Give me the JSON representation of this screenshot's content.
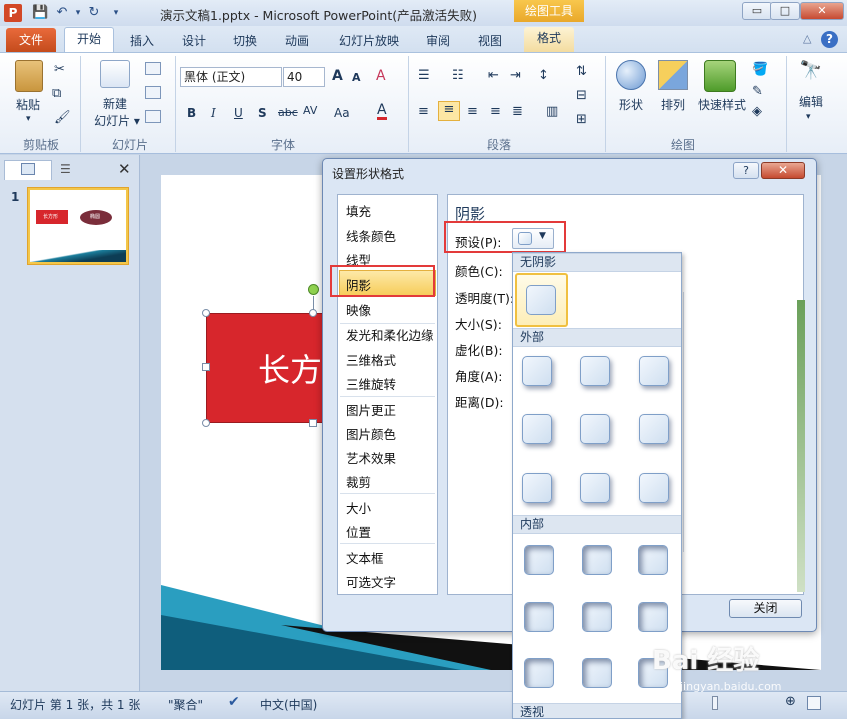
{
  "titlebar": {
    "app_letter": "P",
    "title": "演示文稿1.pptx - Microsoft PowerPoint(产品激活失败)",
    "context_tool": "绘图工具",
    "min": "▭",
    "max": "□",
    "close": "✕"
  },
  "tabs": [
    "文件",
    "开始",
    "插入",
    "设计",
    "切换",
    "动画",
    "幻灯片放映",
    "审阅",
    "视图",
    "格式"
  ],
  "help": {
    "up": "△",
    "q": "?"
  },
  "ribbon": {
    "clipboard": {
      "paste": "粘贴",
      "label": "剪贴板"
    },
    "slides": {
      "new_line1": "新建",
      "new_line2": "幻灯片 ▾",
      "label": "幻灯片"
    },
    "font": {
      "name": "黑体 (正文)",
      "size": "40",
      "grow": "A",
      "shrink": "A",
      "clear": "A",
      "bold": "B",
      "italic": "I",
      "underline": "U",
      "shadow": "S",
      "strike": "abc",
      "spacing": "AV",
      "case": "Aa",
      "color": "A",
      "label": "字体"
    },
    "paragraph": {
      "label": "段落"
    },
    "drawing": {
      "shape": "形状",
      "arrange": "排列",
      "quick": "快速样式",
      "label": "绘图"
    },
    "editing": {
      "edit": "编辑"
    }
  },
  "leftpanel": {
    "slide_num": "1",
    "thumb_rect": "长方形",
    "thumb_oval": "椭圆"
  },
  "slide": {
    "rect_text": "长方"
  },
  "statusbar": {
    "slide_info": "幻灯片 第 1 张，共 1 张",
    "theme": "\"聚合\"",
    "lang": "中文(中国)"
  },
  "dialog": {
    "title": "设置形状格式",
    "help": "?",
    "close": "✕",
    "nav": [
      "填充",
      "线条颜色",
      "线型",
      "阴影",
      "映像",
      "发光和柔化边缘",
      "三维格式",
      "三维旋转",
      "图片更正",
      "图片颜色",
      "艺术效果",
      "裁剪",
      "大小",
      "位置",
      "文本框",
      "可选文字"
    ],
    "selected": "阴影",
    "section": "阴影",
    "props": {
      "preset": "预设(P):",
      "color": "颜色(C):",
      "transparency": "透明度(T):",
      "size": "大小(S):",
      "blur": "虚化(B):",
      "angle": "角度(A):",
      "distance": "距离(D):"
    },
    "close_button": "关闭"
  },
  "gallery": {
    "none": "无阴影",
    "outer": "外部",
    "inner": "内部",
    "perspective": "透视"
  },
  "watermark": {
    "text": "Bai 经验",
    "url": "jingyan.baidu.com"
  },
  "colors": {
    "accent": "#d24726",
    "rect": "#d7262c",
    "select": "#f7cd5b"
  }
}
